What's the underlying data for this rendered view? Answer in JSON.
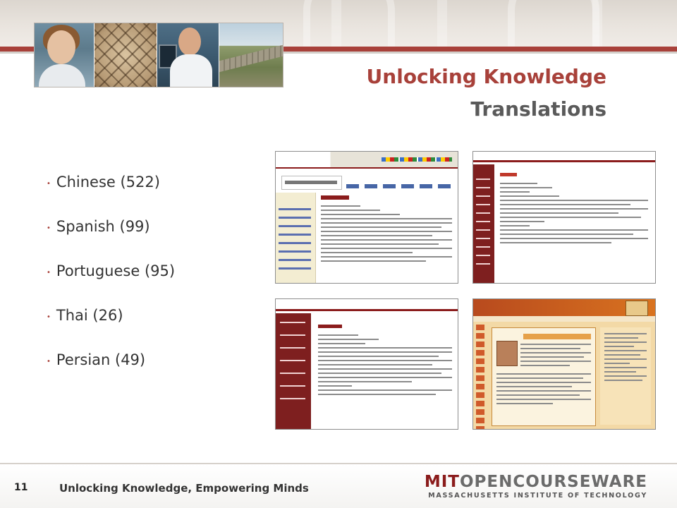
{
  "slide": {
    "title": "Unlocking Knowledge",
    "subtitle": "Translations",
    "languages": [
      "Chinese (522)",
      "Spanish (99)",
      "Portuguese (95)",
      "Thai (26)",
      "Persian (49)"
    ],
    "page_number": "11",
    "footer_text": "Unlocking Knowledge, Empowering Minds"
  },
  "logo": {
    "part_a": "MIT",
    "part_b": "OPENCOURSEWARE",
    "tagline": "MASSACHUSETTS INSTITUTE OF TECHNOLOGY"
  },
  "colors": {
    "accent": "#a8413a",
    "subtitle": "#5a5a5a",
    "body_text": "#333333"
  },
  "icons": {
    "bullet": "•"
  }
}
